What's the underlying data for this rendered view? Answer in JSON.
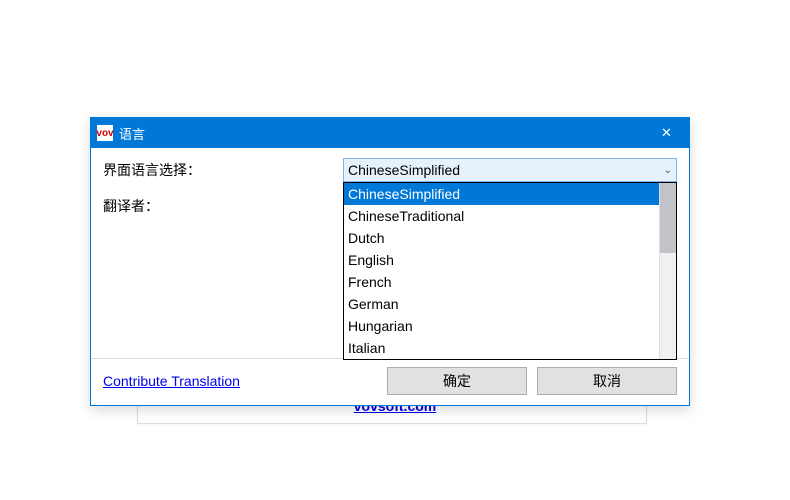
{
  "titlebar": {
    "icon_text": "vov",
    "title": "语言",
    "close_glyph": "✕"
  },
  "labels": {
    "ui_language": "界面语言选择：",
    "translator": "翻译者："
  },
  "combo": {
    "selected": "ChineseSimplified",
    "arrow": "⌄"
  },
  "dropdown": {
    "items": [
      "ChineseSimplified",
      "ChineseTraditional",
      "Dutch",
      "English",
      "French",
      "German",
      "Hungarian",
      "Italian"
    ]
  },
  "footer": {
    "link": "Contribute Translation",
    "ok": "确定",
    "cancel": "取消"
  },
  "background": {
    "back_link": "vovsoft.com"
  }
}
